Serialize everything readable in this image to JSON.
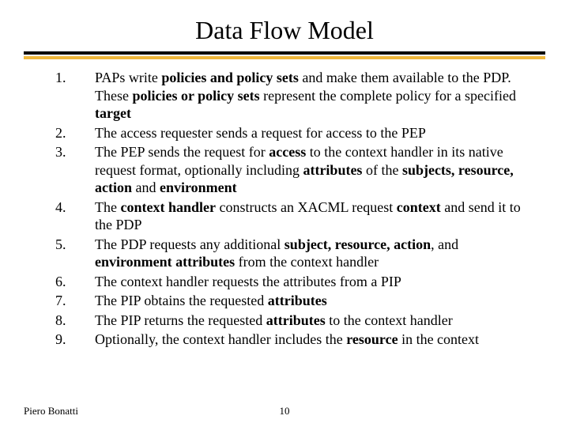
{
  "title": "Data Flow Model",
  "items": [
    {
      "num": "1.",
      "html": "PAPs write <b>policies and policy sets</b> and make them available  to the PDP. These <b>policies or policy sets</b> represent the complete policy for a specified <b>target</b>"
    },
    {
      "num": "2.",
      "html": "The access requester sends a request for access to the PEP"
    },
    {
      "num": "3.",
      "html": "The PEP sends the request for <b>access</b> to the context handler in its native request format, optionally including <b>attributes</b>  of the <b>subjects, resource, action</b> and <b>environment</b>"
    },
    {
      "num": "4.",
      "html": "The <b>context handler</b> constructs an XACML request <b>context</b> and send it to the PDP"
    },
    {
      "num": "5.",
      "html": "The PDP requests any additional <b>subject, resource, action</b>, and <b>environment attributes</b> from the context handler"
    },
    {
      "num": "6.",
      "html": "The context handler requests the attributes from a PIP"
    },
    {
      "num": "7.",
      "html": "The PIP obtains the requested <b>attributes</b>"
    },
    {
      "num": "8.",
      "html": "The PIP returns the requested <b>attributes</b> to the context handler"
    },
    {
      "num": "9.",
      "html": "Optionally, the context handler includes the <b>resource</b> in the context"
    }
  ],
  "footer": {
    "author": "Piero Bonatti",
    "page": "10"
  }
}
